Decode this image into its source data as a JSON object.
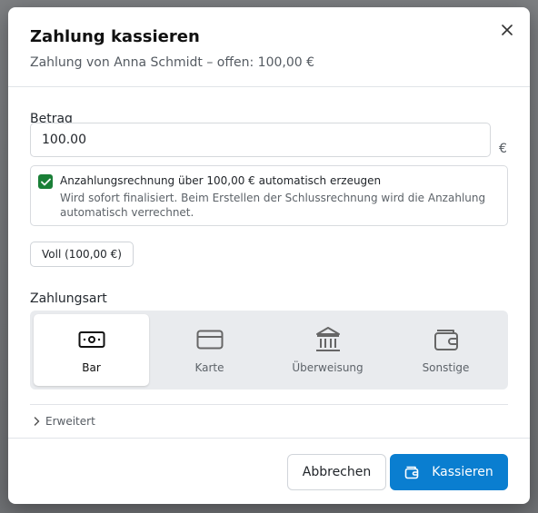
{
  "dialog": {
    "title": "Zahlung kassieren",
    "subtitle": "Zahlung von Anna Schmidt – offen: 100,00 €"
  },
  "amount": {
    "label": "Betrag",
    "value": "100.00",
    "currency": "€"
  },
  "deposit": {
    "checked": true,
    "label": "Anzahlungsrechnung über 100,00 € automatisch erzeugen",
    "hint": "Wird sofort finalisiert. Beim Erstellen der Schlussrechnung wird die Anzahlung automatisch verrechnet."
  },
  "full_button": {
    "label": "Voll (100,00 €)"
  },
  "payment_method": {
    "label": "Zahlungsart",
    "selected": "Bar",
    "options": [
      {
        "label": "Bar",
        "icon": "cash-icon"
      },
      {
        "label": "Karte",
        "icon": "card-icon"
      },
      {
        "label": "Überweisung",
        "icon": "bank-icon"
      },
      {
        "label": "Sonstige",
        "icon": "wallet-icon"
      }
    ]
  },
  "advanced": {
    "label": "Erweitert"
  },
  "footer": {
    "cancel_label": "Abbrechen",
    "submit_label": "Kassieren"
  },
  "colors": {
    "primary": "#0a7ed0",
    "checkbox": "#1a7f37"
  }
}
